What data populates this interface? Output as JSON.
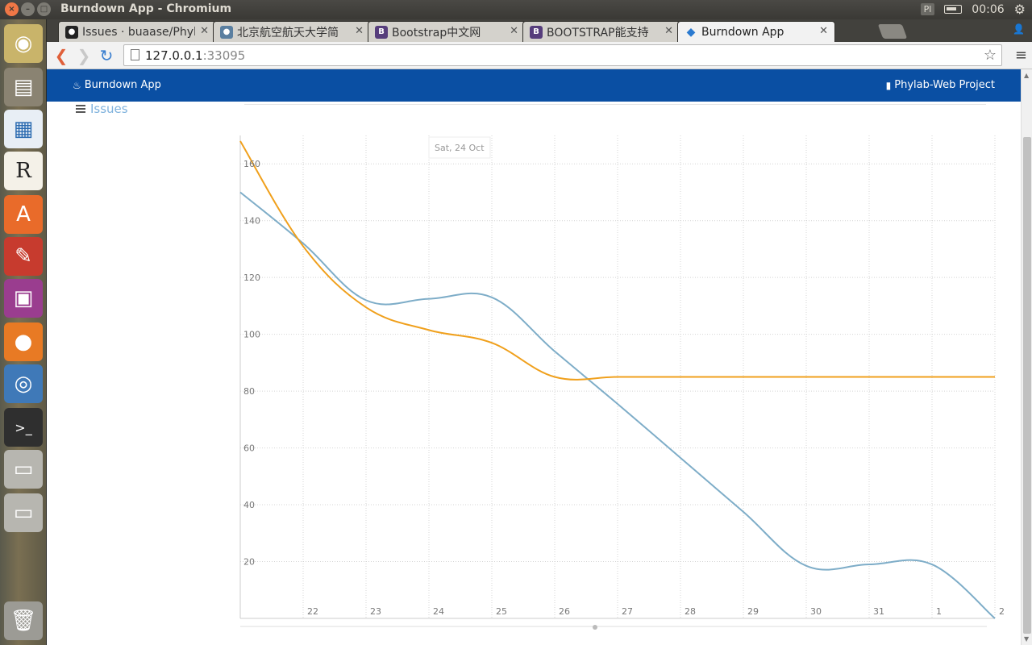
{
  "os": {
    "window_title": "Burndown App - Chromium",
    "tray_indicator": "Pl",
    "clock": "00:06"
  },
  "launcher": {
    "icons": [
      "ubuntu-dash-icon",
      "files-icon",
      "writer-icon",
      "r-app-icon",
      "software-center-icon",
      "system-settings-icon",
      "workspace-icon",
      "firefox-icon",
      "chromium-icon",
      "terminal-icon",
      "drive-icon",
      "drive-icon-2",
      "trash-icon"
    ]
  },
  "browser": {
    "tabs": [
      {
        "label": "Issues · buaase/Phyl",
        "icon": "github-icon",
        "color": "#222222"
      },
      {
        "label": "北京航空航天大学简",
        "icon": "globe-icon",
        "color": "#5a7fa0"
      },
      {
        "label": "Bootstrap中文网",
        "icon": "bootstrap-icon",
        "color": "#563d7c"
      },
      {
        "label": "BOOTSTRAP能支持",
        "icon": "bootstrap-icon",
        "color": "#563d7c"
      },
      {
        "label": "Burndown App",
        "icon": "burndown-icon",
        "color": "#2a7ad0"
      }
    ],
    "url_host": "127.0.0.1",
    "url_port": ":33095"
  },
  "page": {
    "brand": "Burndown App",
    "project_link": "Phylab-Web Project",
    "issues_link": "Issues"
  },
  "chart_data": {
    "type": "line",
    "x_tick_labels": [
      "22",
      "23",
      "24",
      "25",
      "26",
      "27",
      "28",
      "29",
      "30",
      "31",
      "1",
      "2"
    ],
    "xlim": [
      21,
      33
    ],
    "ylim": [
      0,
      170
    ],
    "y_ticks": [
      20,
      40,
      60,
      80,
      100,
      120,
      140,
      160
    ],
    "grid": true,
    "tooltip": "Sat, 24 Oct",
    "series": [
      {
        "color": "#7eadc8",
        "x": [
          21,
          22,
          23,
          24,
          25,
          26,
          27,
          28,
          29,
          30,
          31,
          32,
          33
        ],
        "values": [
          150,
          132,
          112,
          112.5,
          113,
          94,
          75.5,
          56.5,
          37.5,
          18.5,
          19,
          19,
          0
        ]
      },
      {
        "color": "#f0a01c",
        "x": [
          21,
          22,
          23,
          24,
          25,
          26,
          27,
          28,
          29,
          30,
          31,
          32,
          33
        ],
        "values": [
          168,
          131,
          109.5,
          101.5,
          97,
          85,
          85,
          85,
          85,
          85,
          85,
          85,
          85
        ]
      }
    ]
  }
}
